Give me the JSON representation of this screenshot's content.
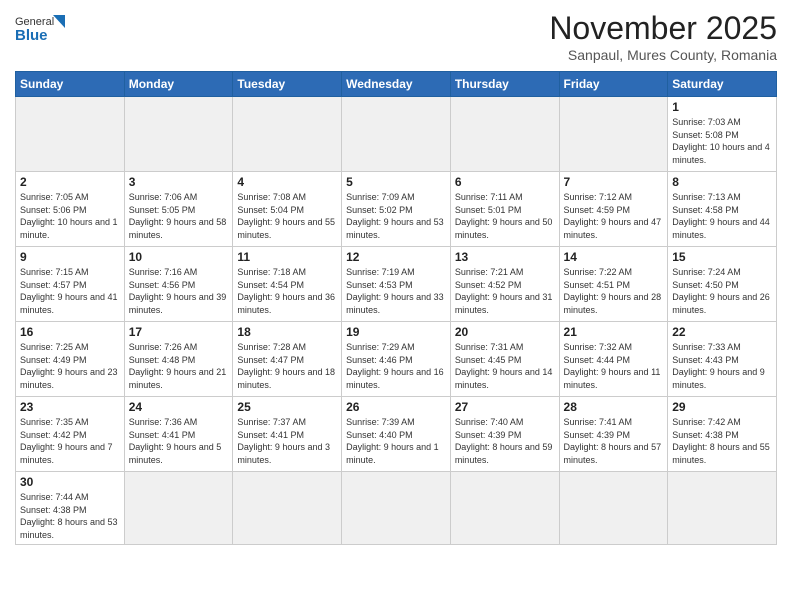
{
  "header": {
    "logo_general": "General",
    "logo_blue": "Blue",
    "month_year": "November 2025",
    "location": "Sanpaul, Mures County, Romania"
  },
  "days_of_week": [
    "Sunday",
    "Monday",
    "Tuesday",
    "Wednesday",
    "Thursday",
    "Friday",
    "Saturday"
  ],
  "weeks": [
    [
      {
        "day": "",
        "info": ""
      },
      {
        "day": "",
        "info": ""
      },
      {
        "day": "",
        "info": ""
      },
      {
        "day": "",
        "info": ""
      },
      {
        "day": "",
        "info": ""
      },
      {
        "day": "",
        "info": ""
      },
      {
        "day": "1",
        "info": "Sunrise: 7:03 AM\nSunset: 5:08 PM\nDaylight: 10 hours and 4 minutes."
      }
    ],
    [
      {
        "day": "2",
        "info": "Sunrise: 7:05 AM\nSunset: 5:06 PM\nDaylight: 10 hours and 1 minute."
      },
      {
        "day": "3",
        "info": "Sunrise: 7:06 AM\nSunset: 5:05 PM\nDaylight: 9 hours and 58 minutes."
      },
      {
        "day": "4",
        "info": "Sunrise: 7:08 AM\nSunset: 5:04 PM\nDaylight: 9 hours and 55 minutes."
      },
      {
        "day": "5",
        "info": "Sunrise: 7:09 AM\nSunset: 5:02 PM\nDaylight: 9 hours and 53 minutes."
      },
      {
        "day": "6",
        "info": "Sunrise: 7:11 AM\nSunset: 5:01 PM\nDaylight: 9 hours and 50 minutes."
      },
      {
        "day": "7",
        "info": "Sunrise: 7:12 AM\nSunset: 4:59 PM\nDaylight: 9 hours and 47 minutes."
      },
      {
        "day": "8",
        "info": "Sunrise: 7:13 AM\nSunset: 4:58 PM\nDaylight: 9 hours and 44 minutes."
      }
    ],
    [
      {
        "day": "9",
        "info": "Sunrise: 7:15 AM\nSunset: 4:57 PM\nDaylight: 9 hours and 41 minutes."
      },
      {
        "day": "10",
        "info": "Sunrise: 7:16 AM\nSunset: 4:56 PM\nDaylight: 9 hours and 39 minutes."
      },
      {
        "day": "11",
        "info": "Sunrise: 7:18 AM\nSunset: 4:54 PM\nDaylight: 9 hours and 36 minutes."
      },
      {
        "day": "12",
        "info": "Sunrise: 7:19 AM\nSunset: 4:53 PM\nDaylight: 9 hours and 33 minutes."
      },
      {
        "day": "13",
        "info": "Sunrise: 7:21 AM\nSunset: 4:52 PM\nDaylight: 9 hours and 31 minutes."
      },
      {
        "day": "14",
        "info": "Sunrise: 7:22 AM\nSunset: 4:51 PM\nDaylight: 9 hours and 28 minutes."
      },
      {
        "day": "15",
        "info": "Sunrise: 7:24 AM\nSunset: 4:50 PM\nDaylight: 9 hours and 26 minutes."
      }
    ],
    [
      {
        "day": "16",
        "info": "Sunrise: 7:25 AM\nSunset: 4:49 PM\nDaylight: 9 hours and 23 minutes."
      },
      {
        "day": "17",
        "info": "Sunrise: 7:26 AM\nSunset: 4:48 PM\nDaylight: 9 hours and 21 minutes."
      },
      {
        "day": "18",
        "info": "Sunrise: 7:28 AM\nSunset: 4:47 PM\nDaylight: 9 hours and 18 minutes."
      },
      {
        "day": "19",
        "info": "Sunrise: 7:29 AM\nSunset: 4:46 PM\nDaylight: 9 hours and 16 minutes."
      },
      {
        "day": "20",
        "info": "Sunrise: 7:31 AM\nSunset: 4:45 PM\nDaylight: 9 hours and 14 minutes."
      },
      {
        "day": "21",
        "info": "Sunrise: 7:32 AM\nSunset: 4:44 PM\nDaylight: 9 hours and 11 minutes."
      },
      {
        "day": "22",
        "info": "Sunrise: 7:33 AM\nSunset: 4:43 PM\nDaylight: 9 hours and 9 minutes."
      }
    ],
    [
      {
        "day": "23",
        "info": "Sunrise: 7:35 AM\nSunset: 4:42 PM\nDaylight: 9 hours and 7 minutes."
      },
      {
        "day": "24",
        "info": "Sunrise: 7:36 AM\nSunset: 4:41 PM\nDaylight: 9 hours and 5 minutes."
      },
      {
        "day": "25",
        "info": "Sunrise: 7:37 AM\nSunset: 4:41 PM\nDaylight: 9 hours and 3 minutes."
      },
      {
        "day": "26",
        "info": "Sunrise: 7:39 AM\nSunset: 4:40 PM\nDaylight: 9 hours and 1 minute."
      },
      {
        "day": "27",
        "info": "Sunrise: 7:40 AM\nSunset: 4:39 PM\nDaylight: 8 hours and 59 minutes."
      },
      {
        "day": "28",
        "info": "Sunrise: 7:41 AM\nSunset: 4:39 PM\nDaylight: 8 hours and 57 minutes."
      },
      {
        "day": "29",
        "info": "Sunrise: 7:42 AM\nSunset: 4:38 PM\nDaylight: 8 hours and 55 minutes."
      }
    ],
    [
      {
        "day": "30",
        "info": "Sunrise: 7:44 AM\nSunset: 4:38 PM\nDaylight: 8 hours and 53 minutes."
      },
      {
        "day": "",
        "info": ""
      },
      {
        "day": "",
        "info": ""
      },
      {
        "day": "",
        "info": ""
      },
      {
        "day": "",
        "info": ""
      },
      {
        "day": "",
        "info": ""
      },
      {
        "day": "",
        "info": ""
      }
    ]
  ]
}
